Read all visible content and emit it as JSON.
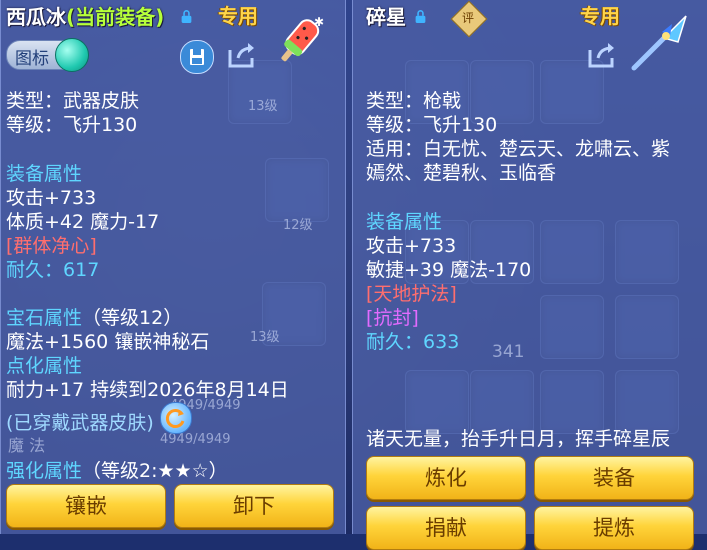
{
  "left": {
    "title_name": "西瓜冰",
    "title_status": "(当前装备)",
    "exclusive_label": "专用",
    "icon_toggle_label": "图标",
    "type_line": "类型：武器皮肤",
    "level_line": "等级：飞升130",
    "equip_attr_heading": "装备属性",
    "attack_line": "攻击+733",
    "stats_line": "体质+42 魔力-17",
    "special_skill": "[群体净心]",
    "durability_label": "耐久：",
    "durability_value": "617",
    "gem_heading": "宝石属性",
    "gem_level": "（等级12）",
    "gem_line": "魔法+1560 镶嵌神秘石",
    "enhance_point_heading": "点化属性",
    "enhance_point_line": "耐力+17 持续到2026年8月14日",
    "worn_note": "(已穿戴武器皮肤)",
    "strengthen_heading": "强化属性",
    "strengthen_level": "（等级2:★★☆）",
    "btn_inlay": "镶嵌",
    "btn_remove": "卸下",
    "bg_tile_labels": [
      "13级",
      "12级",
      "13级"
    ],
    "bg_stat_labels": [
      "4949/4949",
      "魔 法",
      "4949/4949"
    ]
  },
  "right": {
    "title_name": "碎星",
    "rating_badge": "评",
    "exclusive_label": "专用",
    "type_line": "类型：枪戟",
    "level_line": "等级：飞升130",
    "applicable_line1": "适用：白无忧、楚云天、龙啸云、紫",
    "applicable_line2": "嫣然、楚碧秋、玉临香",
    "equip_attr_heading": "装备属性",
    "attack_line": "攻击+733",
    "stats_line": "敏捷+39 魔法-170",
    "special_skill1": "[天地护法]",
    "special_skill2": "[抗封]",
    "durability_label": "耐久：",
    "durability_value": "633",
    "flavor_text": "诸天无量，抬手升日月，挥手碎星辰",
    "btn_refine": "炼化",
    "btn_equip": "装备",
    "btn_donate": "捐献",
    "btn_extract": "提炼",
    "bg_tile_label": "341"
  },
  "colors": {
    "panel_bg": "#4e61a8",
    "heading_cyan": "#5fd6ff",
    "skill_red": "#ff6e6e",
    "skill_magenta": "#e36bff",
    "status_green": "#b6ff3a",
    "exclusive_gold": "#ffd54a",
    "button_gold": "#ffd43a"
  },
  "icons": {
    "left_lock": "lock-icon",
    "right_lock": "lock-icon",
    "save_icon": "save-icon",
    "share_icon": "share-icon",
    "item_icon_left": "watermelon-popsicle-icon",
    "item_icon_right": "spear-icon",
    "refresh_icon": "refresh-icon",
    "toggle": "toggle-switch"
  }
}
